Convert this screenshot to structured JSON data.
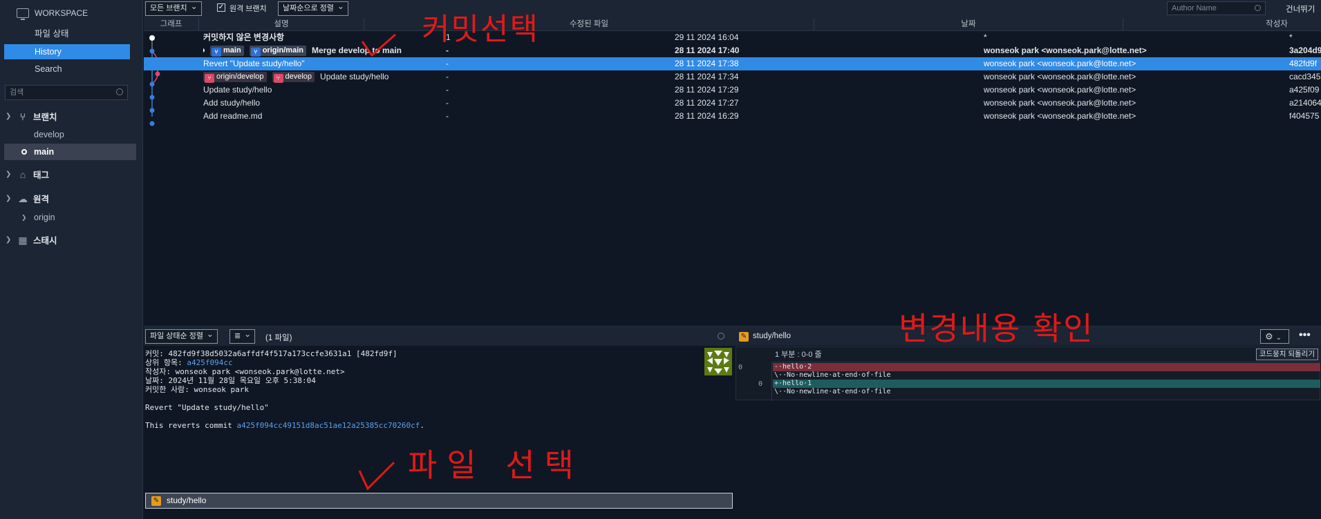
{
  "sidebar": {
    "workspace_title": "WORKSPACE",
    "nav": [
      "파일 상태",
      "History",
      "Search"
    ],
    "search_placeholder": "검색",
    "branches_label": "브랜치",
    "branches": [
      "develop",
      "main"
    ],
    "tags_label": "태그",
    "remotes_label": "원격",
    "remotes": [
      "origin"
    ],
    "stash_label": "스태시"
  },
  "toolbar": {
    "branch_filter": "모든 브랜치",
    "remote_branch_label": "원격 브랜치",
    "sort": "날짜순으로 정렬",
    "author_placeholder": "Author Name",
    "skip": "건너뛰기"
  },
  "table": {
    "columns": [
      "그래프",
      "설명",
      "수정된 파일",
      "날짜",
      "작성자",
      "커밋"
    ],
    "rows": [
      {
        "desc": "커밋하지 않은 변경사항",
        "files": "1",
        "date": "29 11 2024 16:04",
        "author": "*",
        "hash": "*"
      },
      {
        "tags": [
          "main",
          "origin/main"
        ],
        "desc": "Merge develop to main",
        "files": "-",
        "date": "28 11 2024 17:40",
        "author": "wonseok park <wonseok.park@lotte.net>",
        "hash": "3a204d9"
      },
      {
        "desc": "Revert \"Update study/hello\"",
        "files": "-",
        "date": "28 11 2024 17:38",
        "author": "wonseok park <wonseok.park@lotte.net>",
        "hash": "482fd9f"
      },
      {
        "tags": [
          "origin/develop",
          "develop"
        ],
        "desc": "Update study/hello",
        "files": "-",
        "date": "28 11 2024 17:34",
        "author": "wonseok park <wonseok.park@lotte.net>",
        "hash": "cacd345"
      },
      {
        "desc": "Update study/hello",
        "files": "-",
        "date": "28 11 2024 17:29",
        "author": "wonseok park <wonseok.park@lotte.net>",
        "hash": "a425f09"
      },
      {
        "desc": "Add study/hello",
        "files": "-",
        "date": "28 11 2024 17:27",
        "author": "wonseok park <wonseok.park@lotte.net>",
        "hash": "a214064"
      },
      {
        "desc": "Add readme.md",
        "files": "-",
        "date": "28 11 2024 16:29",
        "author": "wonseok park <wonseok.park@lotte.net>",
        "hash": "f404575"
      }
    ]
  },
  "files_panel": {
    "sort": "파일 상태순 정렬",
    "view_icon": "≣",
    "file_count": "(1 파일)",
    "commit_lines": {
      "commit": "커밋: 482fd9f38d5032a6affdf4f517a173ccfe3631a1 [482fd9f]",
      "parent_label": "상위 항목:",
      "parent": "a425f094cc",
      "author": "작성자: wonseok park <wonseok.park@lotte.net>",
      "date": "날짜: 2024년 11월 28일 목요일 오후 5:38:04",
      "committer": "커밋한 사람: wonseok park"
    },
    "message_title": "Revert \"Update study/hello\"",
    "message_body_prefix": "This reverts commit",
    "message_body_link": "a425f094cc49151d8ac51ae12a25385cc70260cf",
    "message_body_suffix": ".",
    "file": "study/hello"
  },
  "diff": {
    "file": "study/hello",
    "hunk": "1 부분 : 0-0 줄",
    "revert_button": "코드뭉치 되돌리기",
    "lines": [
      "-·hello·2",
      "\\··No·newline·at·end·of·file",
      "+·hello·1",
      "\\··No·newline·at·end·of·file"
    ],
    "old_num": "0",
    "new_num": "0"
  },
  "annotations": {
    "commit_select": "커밋선택",
    "file_select": "파일 선택",
    "check_changes": "변경내용 확인"
  }
}
